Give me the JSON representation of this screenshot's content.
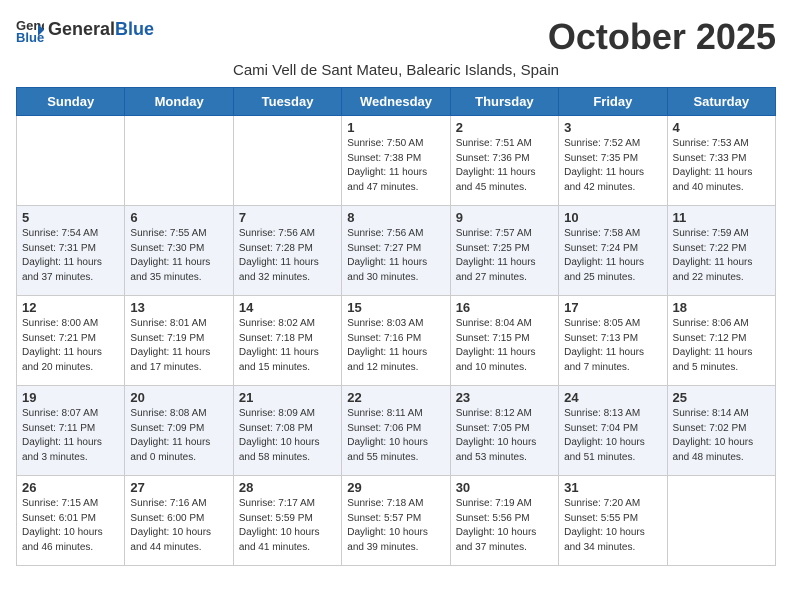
{
  "header": {
    "logo_general": "General",
    "logo_blue": "Blue",
    "month_title": "October 2025",
    "location": "Cami Vell de Sant Mateu, Balearic Islands, Spain"
  },
  "days_of_week": [
    "Sunday",
    "Monday",
    "Tuesday",
    "Wednesday",
    "Thursday",
    "Friday",
    "Saturday"
  ],
  "weeks": [
    [
      {
        "day": "",
        "info": ""
      },
      {
        "day": "",
        "info": ""
      },
      {
        "day": "",
        "info": ""
      },
      {
        "day": "1",
        "info": "Sunrise: 7:50 AM\nSunset: 7:38 PM\nDaylight: 11 hours and 47 minutes."
      },
      {
        "day": "2",
        "info": "Sunrise: 7:51 AM\nSunset: 7:36 PM\nDaylight: 11 hours and 45 minutes."
      },
      {
        "day": "3",
        "info": "Sunrise: 7:52 AM\nSunset: 7:35 PM\nDaylight: 11 hours and 42 minutes."
      },
      {
        "day": "4",
        "info": "Sunrise: 7:53 AM\nSunset: 7:33 PM\nDaylight: 11 hours and 40 minutes."
      }
    ],
    [
      {
        "day": "5",
        "info": "Sunrise: 7:54 AM\nSunset: 7:31 PM\nDaylight: 11 hours and 37 minutes."
      },
      {
        "day": "6",
        "info": "Sunrise: 7:55 AM\nSunset: 7:30 PM\nDaylight: 11 hours and 35 minutes."
      },
      {
        "day": "7",
        "info": "Sunrise: 7:56 AM\nSunset: 7:28 PM\nDaylight: 11 hours and 32 minutes."
      },
      {
        "day": "8",
        "info": "Sunrise: 7:56 AM\nSunset: 7:27 PM\nDaylight: 11 hours and 30 minutes."
      },
      {
        "day": "9",
        "info": "Sunrise: 7:57 AM\nSunset: 7:25 PM\nDaylight: 11 hours and 27 minutes."
      },
      {
        "day": "10",
        "info": "Sunrise: 7:58 AM\nSunset: 7:24 PM\nDaylight: 11 hours and 25 minutes."
      },
      {
        "day": "11",
        "info": "Sunrise: 7:59 AM\nSunset: 7:22 PM\nDaylight: 11 hours and 22 minutes."
      }
    ],
    [
      {
        "day": "12",
        "info": "Sunrise: 8:00 AM\nSunset: 7:21 PM\nDaylight: 11 hours and 20 minutes."
      },
      {
        "day": "13",
        "info": "Sunrise: 8:01 AM\nSunset: 7:19 PM\nDaylight: 11 hours and 17 minutes."
      },
      {
        "day": "14",
        "info": "Sunrise: 8:02 AM\nSunset: 7:18 PM\nDaylight: 11 hours and 15 minutes."
      },
      {
        "day": "15",
        "info": "Sunrise: 8:03 AM\nSunset: 7:16 PM\nDaylight: 11 hours and 12 minutes."
      },
      {
        "day": "16",
        "info": "Sunrise: 8:04 AM\nSunset: 7:15 PM\nDaylight: 11 hours and 10 minutes."
      },
      {
        "day": "17",
        "info": "Sunrise: 8:05 AM\nSunset: 7:13 PM\nDaylight: 11 hours and 7 minutes."
      },
      {
        "day": "18",
        "info": "Sunrise: 8:06 AM\nSunset: 7:12 PM\nDaylight: 11 hours and 5 minutes."
      }
    ],
    [
      {
        "day": "19",
        "info": "Sunrise: 8:07 AM\nSunset: 7:11 PM\nDaylight: 11 hours and 3 minutes."
      },
      {
        "day": "20",
        "info": "Sunrise: 8:08 AM\nSunset: 7:09 PM\nDaylight: 11 hours and 0 minutes."
      },
      {
        "day": "21",
        "info": "Sunrise: 8:09 AM\nSunset: 7:08 PM\nDaylight: 10 hours and 58 minutes."
      },
      {
        "day": "22",
        "info": "Sunrise: 8:11 AM\nSunset: 7:06 PM\nDaylight: 10 hours and 55 minutes."
      },
      {
        "day": "23",
        "info": "Sunrise: 8:12 AM\nSunset: 7:05 PM\nDaylight: 10 hours and 53 minutes."
      },
      {
        "day": "24",
        "info": "Sunrise: 8:13 AM\nSunset: 7:04 PM\nDaylight: 10 hours and 51 minutes."
      },
      {
        "day": "25",
        "info": "Sunrise: 8:14 AM\nSunset: 7:02 PM\nDaylight: 10 hours and 48 minutes."
      }
    ],
    [
      {
        "day": "26",
        "info": "Sunrise: 7:15 AM\nSunset: 6:01 PM\nDaylight: 10 hours and 46 minutes."
      },
      {
        "day": "27",
        "info": "Sunrise: 7:16 AM\nSunset: 6:00 PM\nDaylight: 10 hours and 44 minutes."
      },
      {
        "day": "28",
        "info": "Sunrise: 7:17 AM\nSunset: 5:59 PM\nDaylight: 10 hours and 41 minutes."
      },
      {
        "day": "29",
        "info": "Sunrise: 7:18 AM\nSunset: 5:57 PM\nDaylight: 10 hours and 39 minutes."
      },
      {
        "day": "30",
        "info": "Sunrise: 7:19 AM\nSunset: 5:56 PM\nDaylight: 10 hours and 37 minutes."
      },
      {
        "day": "31",
        "info": "Sunrise: 7:20 AM\nSunset: 5:55 PM\nDaylight: 10 hours and 34 minutes."
      },
      {
        "day": "",
        "info": ""
      }
    ]
  ]
}
